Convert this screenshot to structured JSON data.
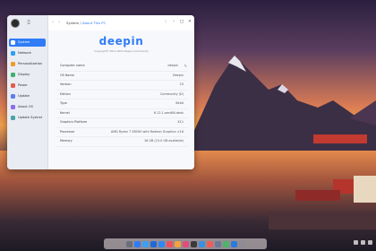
{
  "window": {
    "breadcrumb": {
      "parent": "System",
      "separator": "/",
      "current": "About This PC"
    },
    "controls": {
      "menu": "⋮",
      "minimize": "–",
      "maximize": "□",
      "close": "✕"
    }
  },
  "sidebar": {
    "items": [
      {
        "label": "System",
        "color": "#2f7cf6",
        "active": true
      },
      {
        "label": "Network",
        "color": "#2ba0f2",
        "active": false
      },
      {
        "label": "Personalization",
        "color": "#f29a2b",
        "active": false
      },
      {
        "label": "Display",
        "color": "#3bb36a",
        "active": false
      },
      {
        "label": "Power",
        "color": "#e25b4d",
        "active": false
      },
      {
        "label": "Update",
        "color": "#5b7df0",
        "active": false
      },
      {
        "label": "About OS",
        "color": "#8a6cf0",
        "active": false
      },
      {
        "label": "Update Sysinst",
        "color": "#4aa3a8",
        "active": false
      }
    ]
  },
  "about": {
    "brand": "deepin",
    "copyright": "Copyright© 2011-2024 Deepin Community",
    "rows": [
      {
        "key": "Computer name",
        "value": "deepin",
        "editable": true
      },
      {
        "key": "OS Name",
        "value": "Deepin",
        "editable": false
      },
      {
        "key": "Version",
        "value": "23",
        "editable": false
      },
      {
        "key": "Edition",
        "value": "Community (D)",
        "editable": false
      },
      {
        "key": "Type",
        "value": "64bit",
        "editable": false
      },
      {
        "key": "Kernel",
        "value": "6.12.1-amd64-desk",
        "editable": false
      },
      {
        "key": "Graphics Platform",
        "value": "X11",
        "editable": false
      },
      {
        "key": "Processor",
        "value": "AMD Ryzen 7 5800H with Radeon Graphics ×16",
        "editable": false
      },
      {
        "key": "Memory",
        "value": "16 GB (15.0 GB available)",
        "editable": false
      }
    ]
  },
  "dock": {
    "apps": [
      {
        "name": "launcher-icon",
        "color": "#6a6f7c"
      },
      {
        "name": "multitask-icon",
        "color": "#2f7cf6"
      },
      {
        "name": "file-manager-icon",
        "color": "#3aa0f2"
      },
      {
        "name": "browser-icon",
        "color": "#1f6ad8"
      },
      {
        "name": "app-store-icon",
        "color": "#2f86f6"
      },
      {
        "name": "music-icon",
        "color": "#f0505e"
      },
      {
        "name": "photos-icon",
        "color": "#f2a33a"
      },
      {
        "name": "video-icon",
        "color": "#e24b7c"
      },
      {
        "name": "terminal-icon",
        "color": "#3a3a3a"
      },
      {
        "name": "mail-icon",
        "color": "#3b8fe0"
      },
      {
        "name": "calendar-icon",
        "color": "#f25c54"
      },
      {
        "name": "settings-icon",
        "color": "#6b7a99"
      },
      {
        "name": "editor-icon",
        "color": "#4fb36a"
      },
      {
        "name": "manual-icon",
        "color": "#2a7adf"
      },
      {
        "name": "trash-icon",
        "color": "#8c8c96"
      }
    ]
  }
}
